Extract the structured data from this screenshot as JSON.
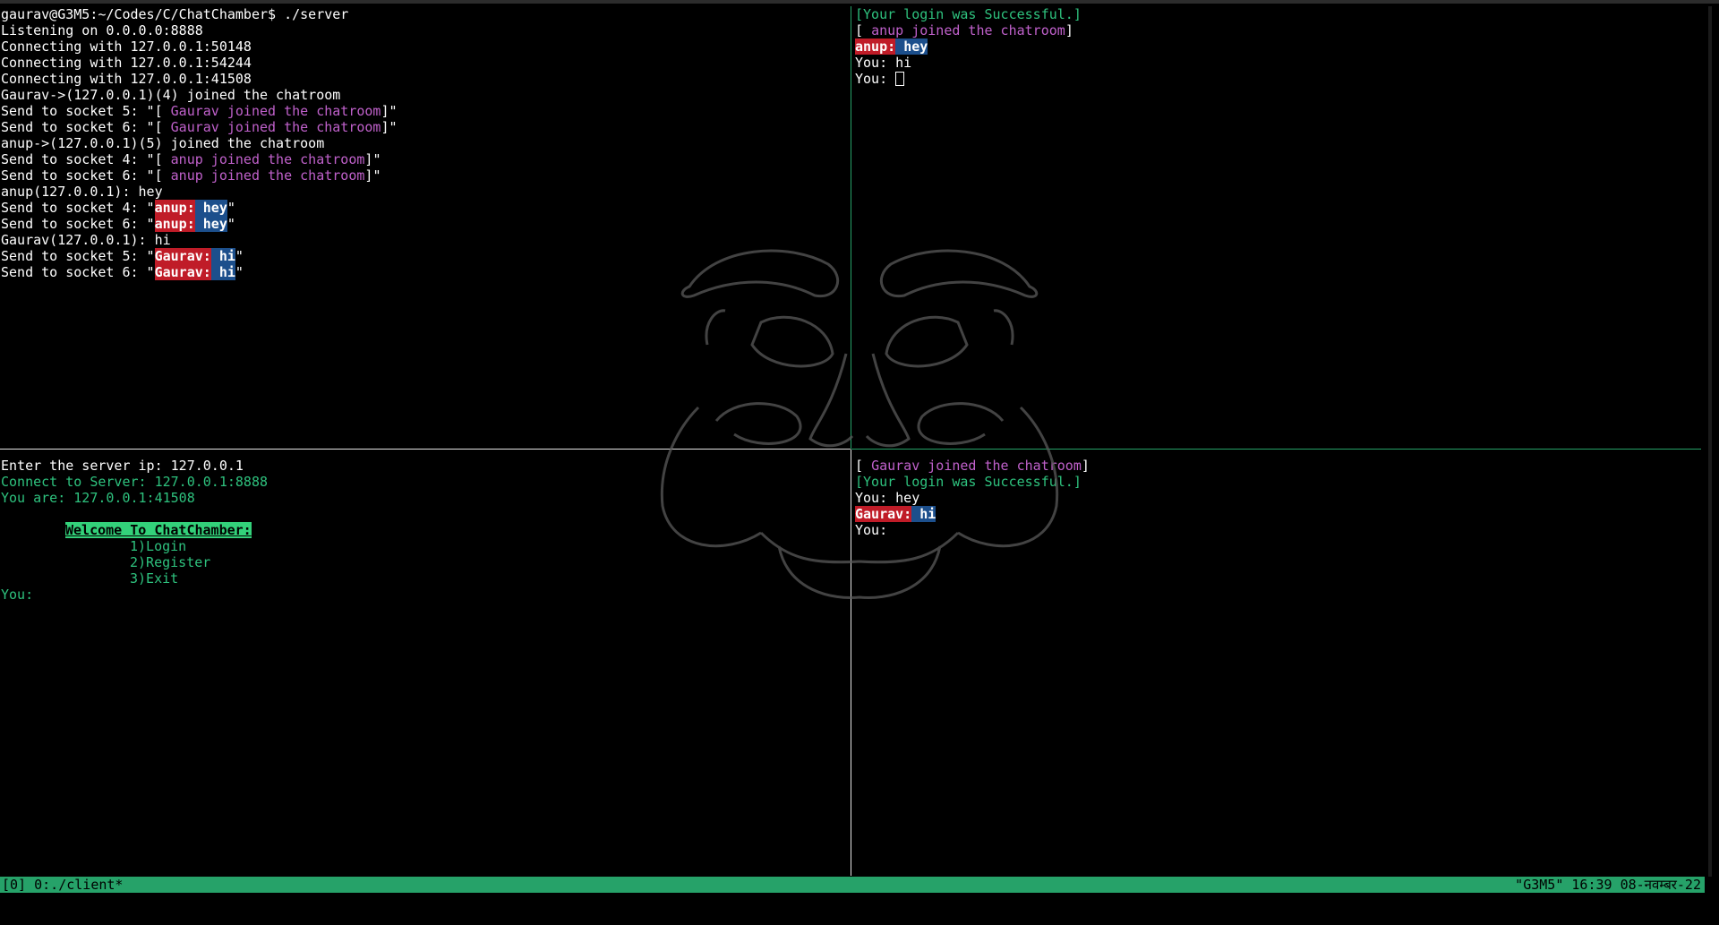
{
  "server": {
    "lines": [
      "gaurav@G3M5:~/Codes/C/ChatChamber$ ./server",
      "Listening on 0.0.0.0:8888",
      "Connecting with 127.0.0.1:50148",
      "Connecting with 127.0.0.1:54244",
      "Connecting with 127.0.0.1:41508",
      "Gaurav->(127.0.0.1)(4) joined the chatroom",
      "anup->(127.0.0.1)(5) joined the chatroom",
      "anup(127.0.0.1): hey",
      "Gaurav(127.0.0.1): hi"
    ],
    "send_to_5": "Send to socket 5: \"",
    "send_to_6": "Send to socket 6: \"",
    "send_to_4": "Send to socket 4: \"",
    "quote_end": "\"",
    "join_open": "[ ",
    "join_close": "]",
    "gaurav_joined": "Gaurav joined the chatroom",
    "anup_joined": "anup joined the chatroom",
    "anup_name": "anup:",
    "gaurav_name": "Gaurav:",
    "msg_hey": "hey",
    "msg_hi": "hi"
  },
  "client_top_right": {
    "login_success": "[Your login was Successful.]",
    "join_open": "[ ",
    "anup_joined": "anup joined the chatroom",
    "join_close": "]",
    "anup_name": "anup:",
    "msg_hey": "hey",
    "you_hi": "You: hi",
    "you_prompt": "You: "
  },
  "client_bottom_left": {
    "enter_ip": "Enter the server ip: 127.0.0.1",
    "connect": "Connect to Server: 127.0.0.1:8888",
    "you_are": "You are: 127.0.0.1:41508",
    "welcome": "Welcome To ChatChamber:",
    "menu": [
      "1)Login",
      "2)Register",
      "3)Exit"
    ],
    "you_prompt": "You:"
  },
  "client_bottom_right": {
    "join_open": "[ ",
    "gaurav_joined": "Gaurav joined the chatroom",
    "join_close": "]",
    "login_success": "[Your login was Successful.]",
    "you_hey": "You: hey",
    "gaurav_name": "Gaurav:",
    "msg_hi": "hi",
    "you_prompt": "You:"
  },
  "statusbar": {
    "left": "[0] 0:./client*",
    "right": "\"G3M5\" 16:39 08-नवम्बर-22"
  },
  "colors": {
    "pane_border_active": "#26a269",
    "status_bg": "#26a269",
    "name_badge": "#c01c28",
    "message_badge": "#1c4f8c",
    "join_text": "#c061cb",
    "system_text": "#2ec27e"
  }
}
